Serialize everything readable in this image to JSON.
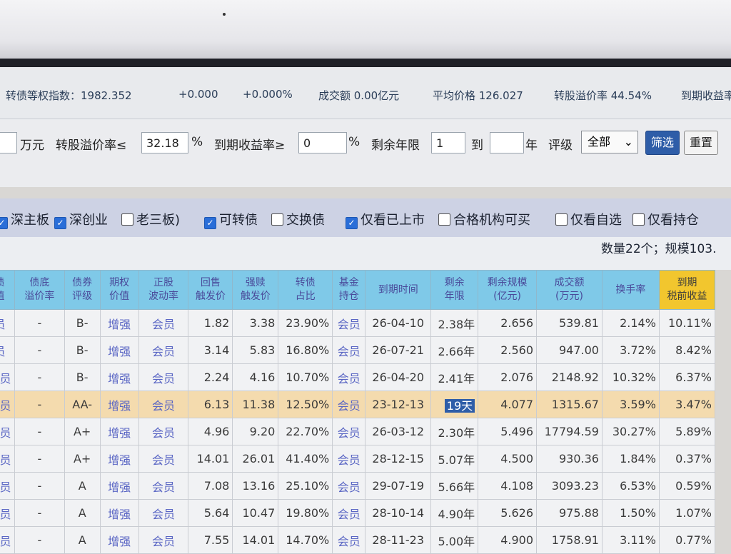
{
  "index_bar": {
    "index": "转债等权指数：1982.352",
    "change": "+0.000",
    "change_pct": "+0.000%",
    "turnover": "成交额 0.00亿元",
    "avg_price": "平均价格 126.027",
    "premium": "转股溢价率 44.54%",
    "ytm": "到期收益率"
  },
  "filters": {
    "unit_label": "万元",
    "premium_label": "转股溢价率≤",
    "premium_value": "32.18",
    "pct1": "%",
    "ytm_label": "到期收益率≥",
    "ytm_value": "0",
    "pct2": "%",
    "years_label": "剩余年限",
    "years_from": "1",
    "to_label": "到",
    "years_to": "",
    "year_unit": "年",
    "rating_label": "评级",
    "rating_selected": "全部",
    "filter_button": "筛选",
    "reset_button": "重置"
  },
  "checkboxes": [
    {
      "label": "深主板",
      "checked": true
    },
    {
      "label": "深创业",
      "checked": true
    },
    {
      "label": "老三板)",
      "checked": false
    },
    {
      "label": "可转债",
      "checked": true
    },
    {
      "label": "交换债",
      "checked": false
    },
    {
      "label": "仅看已上市",
      "checked": true
    },
    {
      "label": "合格机构可买",
      "checked": false
    },
    {
      "label": "仅看自选",
      "checked": false
    },
    {
      "label": "仅看持仓",
      "checked": false
    }
  ],
  "summary": "数量22个；规模103.",
  "table": {
    "headers": [
      "债\n值",
      "债底\n溢价率",
      "债券\n评级",
      "期权\n价值",
      "正股\n波动率",
      "回售\n触发价",
      "强赎\n触发价",
      "转债\n占比",
      "基金\n持仓",
      "到期时间",
      "剩余\n年限",
      "剩余规模\n(亿元)",
      "成交额\n(万元)",
      "换手率",
      "到期\n税前收益"
    ],
    "rows": [
      [
        "员",
        "-",
        "B-",
        "增强",
        "会员",
        "1.82",
        "3.38",
        "23.90%",
        "会员",
        "26-04-10",
        "2.38年",
        "2.656",
        "539.81",
        "2.14%",
        "10.11%"
      ],
      [
        "员",
        "-",
        "B-",
        "增强",
        "会员",
        "3.14",
        "5.83",
        "16.80%",
        "会员",
        "26-07-21",
        "2.66年",
        "2.560",
        "947.00",
        "3.72%",
        "8.42%"
      ],
      [
        "会员",
        "-",
        "B-",
        "增强",
        "会员",
        "2.24",
        "4.16",
        "10.70%",
        "会员",
        "26-04-20",
        "2.41年",
        "2.076",
        "2148.92",
        "10.32%",
        "6.37%"
      ],
      [
        "会员",
        "-",
        "AA-",
        "增强",
        "会员",
        "6.13",
        "11.38",
        "12.50%",
        "会员",
        "23-12-13",
        "19天",
        "4.077",
        "1315.67",
        "3.59%",
        "3.47%"
      ],
      [
        "会员",
        "-",
        "A+",
        "增强",
        "会员",
        "4.96",
        "9.20",
        "22.70%",
        "会员",
        "26-03-12",
        "2.30年",
        "5.496",
        "17794.59",
        "30.27%",
        "5.89%"
      ],
      [
        "会员",
        "-",
        "A+",
        "增强",
        "会员",
        "14.01",
        "26.01",
        "41.40%",
        "会员",
        "28-12-15",
        "5.07年",
        "4.500",
        "930.36",
        "1.84%",
        "0.37%"
      ],
      [
        "会员",
        "-",
        "A",
        "增强",
        "会员",
        "7.08",
        "13.16",
        "25.10%",
        "会员",
        "29-07-19",
        "5.66年",
        "4.108",
        "3093.23",
        "6.53%",
        "0.59%"
      ],
      [
        "会员",
        "-",
        "A",
        "增强",
        "会员",
        "5.64",
        "10.47",
        "19.80%",
        "会员",
        "28-10-14",
        "4.90年",
        "5.626",
        "975.88",
        "1.50%",
        "1.07%"
      ],
      [
        "会员",
        "-",
        "A",
        "增强",
        "会员",
        "7.55",
        "14.01",
        "14.70%",
        "会员",
        "28-11-23",
        "5.00年",
        "4.900",
        "1758.91",
        "3.11%",
        "0.77%"
      ]
    ],
    "highlight_row": 3
  }
}
